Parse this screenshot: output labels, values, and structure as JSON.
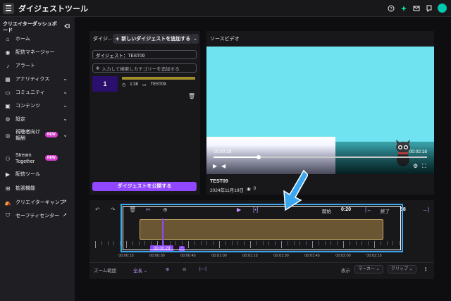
{
  "app": {
    "title": "ダイジェストツール"
  },
  "colors": {
    "accent": "#9147ff",
    "highlight": "#3aa6f0",
    "new_badge": "#d63fce",
    "avatar": "#00c8af"
  },
  "sidebar": {
    "header": "クリエイターダッシュボード",
    "items": [
      {
        "label": "ホーム",
        "icon": "home-icon"
      },
      {
        "label": "配信マネージャー",
        "icon": "broadcast-icon"
      },
      {
        "label": "アラート",
        "icon": "alert-icon"
      },
      {
        "label": "アナリティクス",
        "icon": "analytics-icon"
      },
      {
        "label": "コミュニティ",
        "icon": "community-icon"
      },
      {
        "label": "コンテンツ",
        "icon": "content-icon"
      },
      {
        "label": "設定",
        "icon": "gear-icon"
      },
      {
        "label": "視聴者向け報酬",
        "icon": "reward-icon",
        "badge": "NEW"
      },
      {
        "label": "Stream Together",
        "icon": "stream-together-icon",
        "badge": "NEW"
      },
      {
        "label": "配信ツール",
        "icon": "tools-icon"
      },
      {
        "label": "拡張機能",
        "icon": "extensions-icon"
      },
      {
        "label": "クリエイターキャンプ",
        "icon": "camp-icon"
      },
      {
        "label": "セーフティセンター",
        "icon": "shield-icon"
      }
    ]
  },
  "digest_panel": {
    "header": "ダイジ...",
    "add_button": "新しいダイジェストを追加する",
    "name_field": "ダイジェスト：TEST09",
    "category_placeholder": "入力して検索しカテゴリーを追加する",
    "clip": {
      "number": "1",
      "duration": "1:38",
      "title": "TEST09"
    },
    "publish_button": "ダイジェストを公開する"
  },
  "video_panel": {
    "title": "ソースビデオ",
    "current_time": "00:00:29",
    "total_time": "00:02:18",
    "progress": 0.21,
    "video_name": "TEST09",
    "date": "2024年11月19日",
    "views": "0"
  },
  "timeline": {
    "start_label": "開始",
    "start_value": "0:20",
    "end_label": "終了",
    "end_value": "58",
    "playhead_time": "00:00:29",
    "ruler_labels": [
      "00:00:15",
      "00:00:30",
      "00:00:45",
      "00:01:00",
      "00:01:15",
      "00:01:30",
      "00:01:45",
      "00:02:00",
      "00:02:15"
    ],
    "zoom_label": "ズーム範囲",
    "zoom_value": "全長",
    "display_label": "表示",
    "marker_dropdown": "マーカー",
    "clip_dropdown": "クリップ"
  }
}
